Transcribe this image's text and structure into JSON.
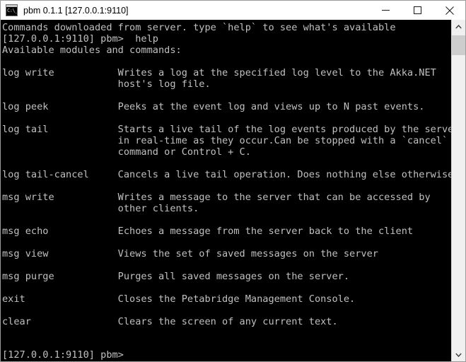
{
  "window": {
    "title": "pbm 0.1.1 [127.0.0.1:9110]",
    "icon_name": "console-app-icon",
    "icon_glyph": "C:\\_",
    "background_color": "#000000",
    "text_color": "#c0c0c0",
    "titlebar_color": "#ffffff",
    "controls": {
      "minimize": "Minimize",
      "maximize": "Maximize",
      "close": "Close"
    }
  },
  "console": {
    "header_lines": [
      "Commands downloaded from server. type `help` to see what's available",
      "[127.0.0.1:9110] pbm>  help",
      "Available modules and commands:"
    ],
    "commands": [
      {
        "name": "log write",
        "description_lines": [
          "Writes a log at the specified log level to the Akka.NET",
          "host's log file."
        ]
      },
      {
        "name": "log peek",
        "description_lines": [
          "Peeks at the event log and views up to N past events."
        ]
      },
      {
        "name": "log tail",
        "description_lines": [
          "Starts a live tail of the log events produced by the server",
          "in real-time as they occur.Can be stopped with a `cancel`",
          "command or Control + C."
        ]
      },
      {
        "name": "log tail-cancel",
        "description_lines": [
          "Cancels a live tail operation. Does nothing else otherwise."
        ]
      },
      {
        "name": "msg write",
        "description_lines": [
          "Writes a message to the server that can be accessed by",
          "other clients."
        ]
      },
      {
        "name": "msg echo",
        "description_lines": [
          "Echoes a message from the server back to the client"
        ]
      },
      {
        "name": "msg view",
        "description_lines": [
          "Views the set of saved messages on the server"
        ]
      },
      {
        "name": "msg purge",
        "description_lines": [
          "Purges all saved messages on the server."
        ]
      },
      {
        "name": "exit",
        "description_lines": [
          "Closes the Petabridge Management Console."
        ]
      },
      {
        "name": "clear",
        "description_lines": [
          "Clears the screen of any current text."
        ]
      }
    ],
    "prompt": "[127.0.0.1:9110] pbm>",
    "description_column": 20
  },
  "scrollbar": {
    "up_arrow": "scroll-up",
    "down_arrow": "scroll-down",
    "track_color": "#f0f0f0",
    "thumb_color": "#cdcdcd"
  }
}
